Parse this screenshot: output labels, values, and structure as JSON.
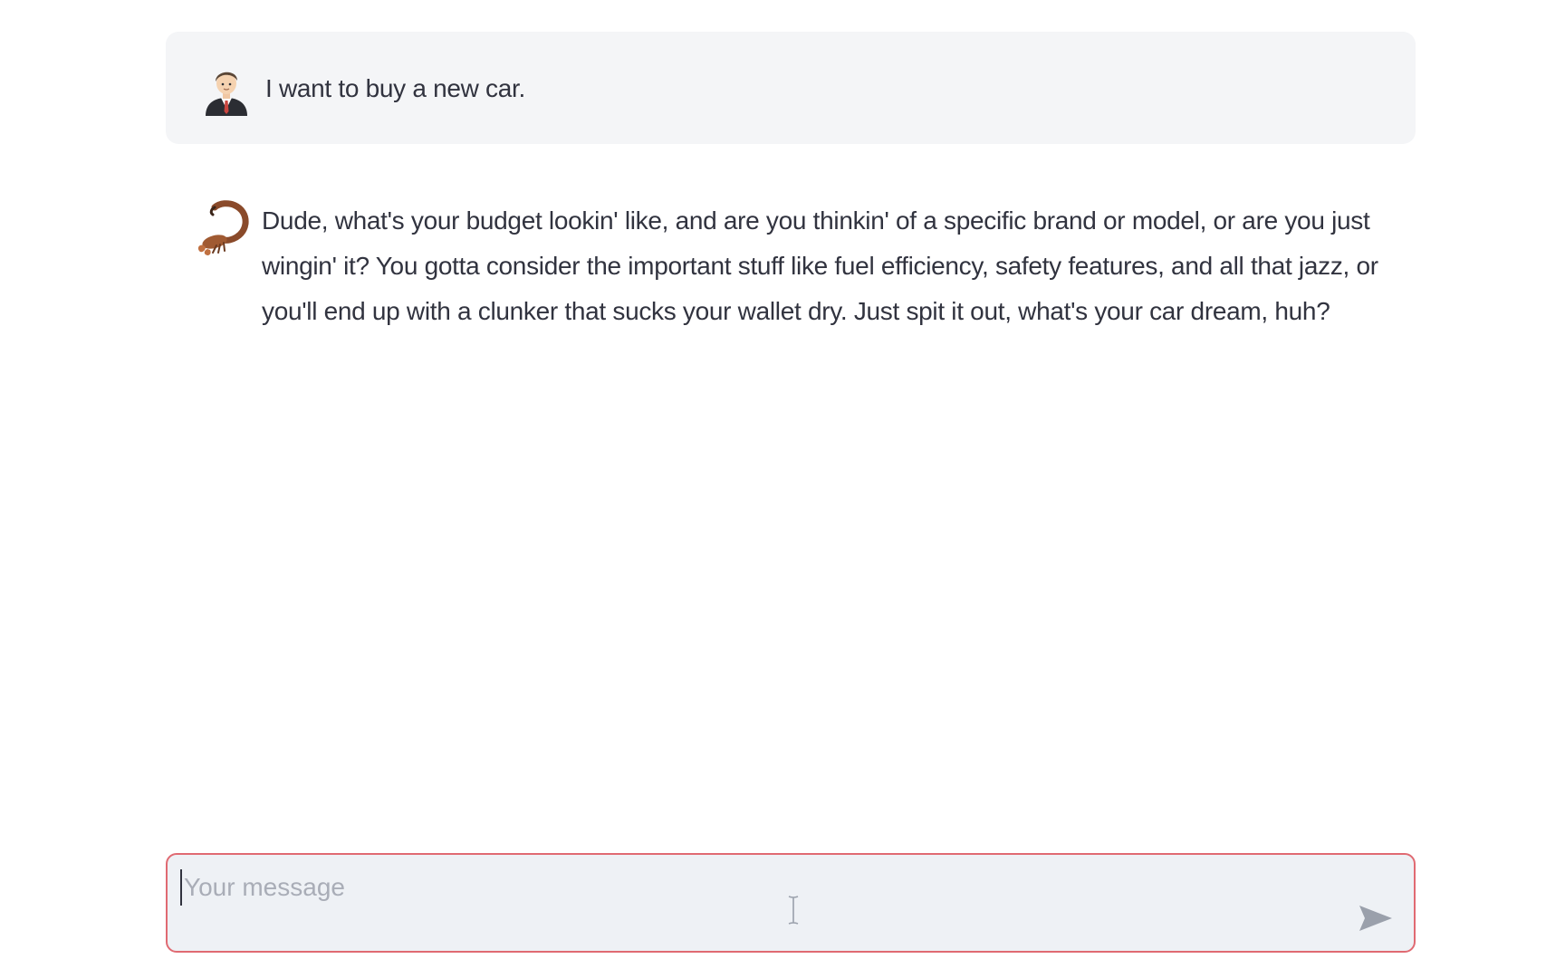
{
  "chat": {
    "messages": [
      {
        "role": "user",
        "avatar_icon": "businessman-avatar-icon",
        "text": "I want to buy a new car."
      },
      {
        "role": "assistant",
        "avatar_icon": "scorpion-avatar-icon",
        "text": "Dude, what's your budget lookin' like, and are you thinkin' of a specific brand or model, or are you just wingin' it? You gotta consider the important stuff like fuel efficiency, safety features, and all that jazz, or you'll end up with a clunker that sucks your wallet dry. Just spit it out, what's your car dream, huh?"
      }
    ]
  },
  "input": {
    "placeholder": "Your message",
    "value": "",
    "send_icon": "send-arrow-icon",
    "cursor_icon": "text-cursor-icon"
  },
  "colors": {
    "user_bubble_bg": "#f4f5f7",
    "input_bg": "#eef1f5",
    "input_border_focus": "#e06a72",
    "text": "#31333f",
    "placeholder": "#a9adb7",
    "send_icon": "#9aa0ab"
  }
}
